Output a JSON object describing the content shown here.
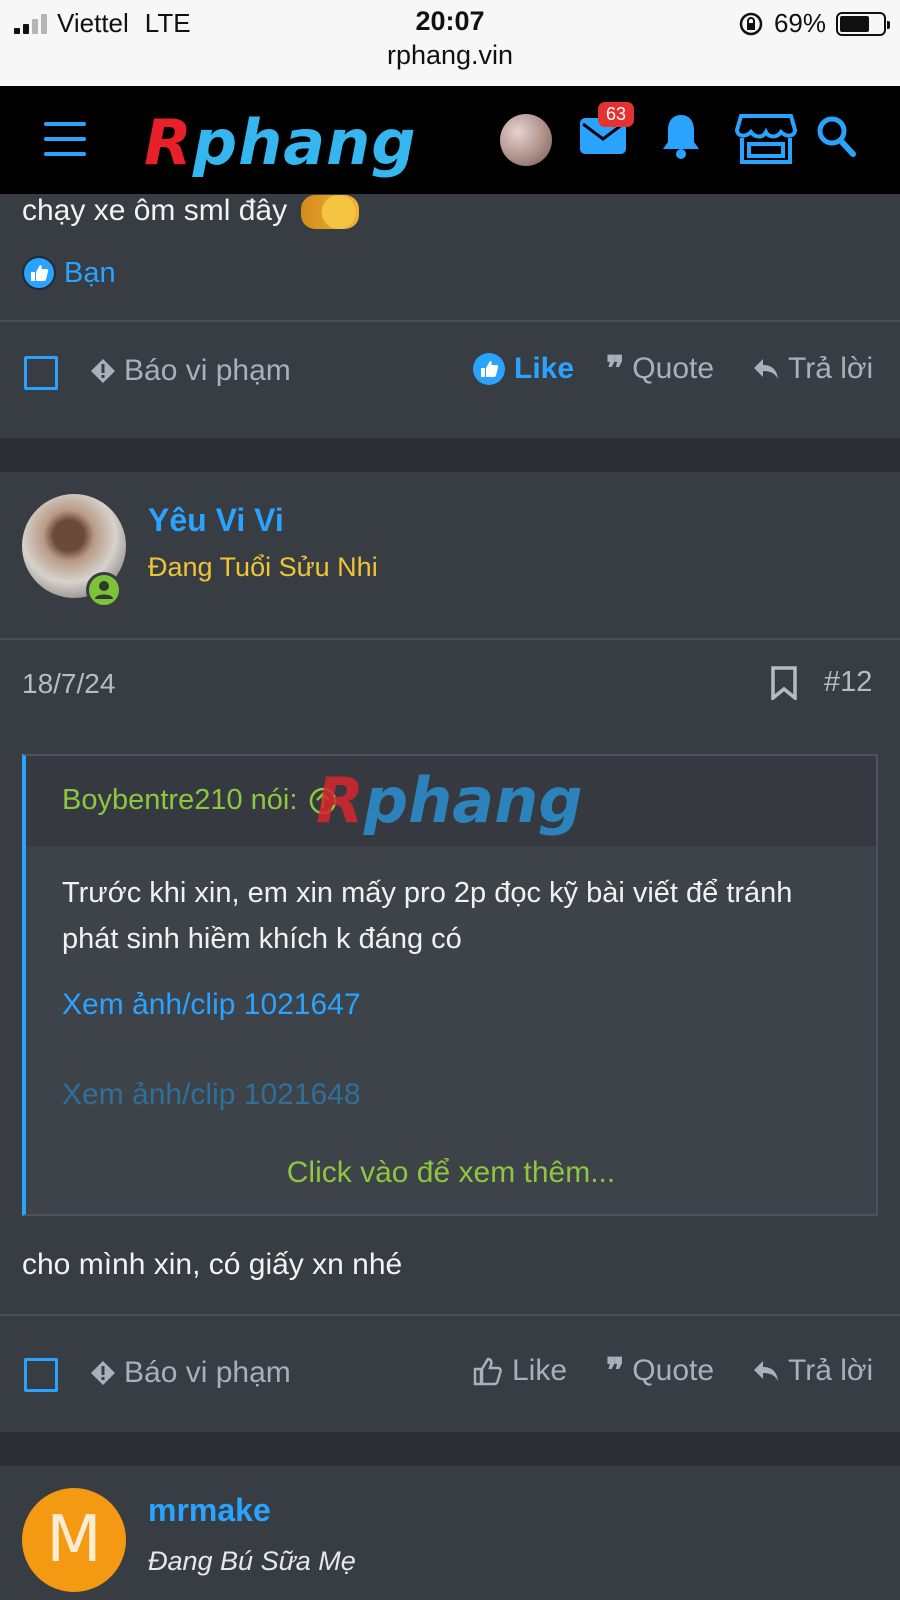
{
  "status_bar": {
    "carrier": "Viettel",
    "network": "LTE",
    "time": "20:07",
    "url": "rphang.vin",
    "battery": "69%",
    "battery_level": 0.69
  },
  "header": {
    "logo_first": "R",
    "logo_rest": "phang",
    "mail_badge": "63",
    "accent_color": "#2aa3ff"
  },
  "prev_post": {
    "text": "chạy xe ôm sml đây",
    "reaction_label": "Bạn",
    "actions": {
      "report": "Báo vi phạm",
      "like": "Like",
      "quote": "Quote",
      "reply": "Trả lời"
    }
  },
  "post12": {
    "username": "Yêu Vi Vi",
    "user_title": "Đang Tuổi Sửu Nhi",
    "date": "18/7/24",
    "number": "#12",
    "quote": {
      "author": "Boybentre210 nói:",
      "watermark_first": "R",
      "watermark_rest": "phang",
      "text": "Trước khi xin, em xin mấy pro 2p đọc kỹ bài viết để tránh phát sinh hiềm khích k đáng có",
      "link1": "Xem ảnh/clip 1021647",
      "link2": "Xem ảnh/clip 1021648",
      "more": "Click vào để xem thêm..."
    },
    "reply_text": "cho mình xin, có giấy xn nhé",
    "actions": {
      "report": "Báo vi phạm",
      "like": "Like",
      "quote": "Quote",
      "reply": "Trả lời"
    }
  },
  "next_post": {
    "avatar_letter": "M",
    "username": "mrmake",
    "user_title": "Đang Bú Sữa Mẹ"
  }
}
